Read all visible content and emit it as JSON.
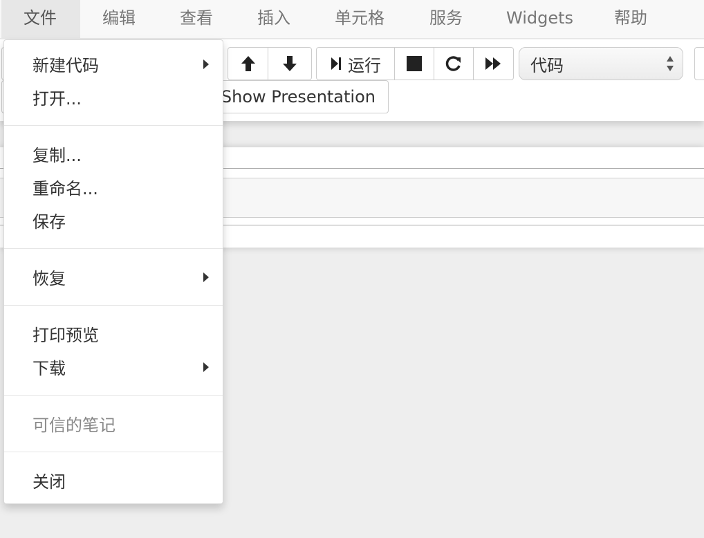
{
  "menubar": {
    "items": [
      {
        "label": "文件",
        "active": true
      },
      {
        "label": "编辑"
      },
      {
        "label": "查看"
      },
      {
        "label": "插入"
      },
      {
        "label": "单元格"
      },
      {
        "label": "服务"
      },
      {
        "label": "Widgets"
      },
      {
        "label": "帮助"
      }
    ]
  },
  "toolbar": {
    "run_label": "运行",
    "cell_type": "代码",
    "show_presentation": "Show Presentation"
  },
  "file_menu": {
    "items": [
      {
        "label": "新建代码",
        "submenu": true
      },
      {
        "label": "打开..."
      },
      {
        "label": "复制..."
      },
      {
        "label": "重命名..."
      },
      {
        "label": "保存"
      },
      {
        "label": "恢复",
        "submenu": true
      },
      {
        "label": "打印预览"
      },
      {
        "label": "下载",
        "submenu": true
      },
      {
        "label": "可信的笔记",
        "disabled": true
      },
      {
        "label": "关闭"
      }
    ]
  },
  "colors": {
    "menubar_bg": "#f8f8f8",
    "menubar_active_bg": "#e7e7e7",
    "page_bg": "#eeeeee",
    "disabled_text": "#888888"
  }
}
